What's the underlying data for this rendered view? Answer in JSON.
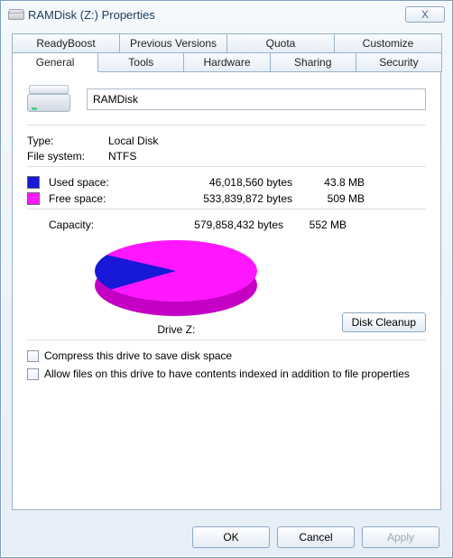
{
  "window": {
    "title": "RAMDisk (Z:) Properties",
    "close_glyph": "X"
  },
  "tabs_row1": {
    "readyboost": "ReadyBoost",
    "previous": "Previous Versions",
    "quota": "Quota",
    "customize": "Customize"
  },
  "tabs_row2": {
    "general": "General",
    "tools": "Tools",
    "hardware": "Hardware",
    "sharing": "Sharing",
    "security": "Security"
  },
  "drive": {
    "name_value": "RAMDisk",
    "type_label": "Type:",
    "type_value": "Local Disk",
    "fs_label": "File system:",
    "fs_value": "NTFS"
  },
  "space": {
    "used_label": "Used space:",
    "used_bytes": "46,018,560 bytes",
    "used_mb": "43.8 MB",
    "free_label": "Free space:",
    "free_bytes": "533,839,872 bytes",
    "free_mb": "509 MB",
    "capacity_label": "Capacity:",
    "capacity_bytes": "579,858,432 bytes",
    "capacity_mb": "552 MB"
  },
  "pie": {
    "drive_label": "Drive Z:",
    "cleanup_button": "Disk Cleanup"
  },
  "checks": {
    "compress": "Compress this drive to save disk space",
    "index": "Allow files on this drive to have contents indexed in addition to file properties"
  },
  "footer": {
    "ok": "OK",
    "cancel": "Cancel",
    "apply": "Apply"
  },
  "colors": {
    "used": "#1818d8",
    "free": "#ff18ff"
  },
  "chart_data": {
    "type": "pie",
    "title": "Drive Z:",
    "series": [
      {
        "name": "Used space",
        "value": 46018560,
        "display": "43.8 MB",
        "color": "#1818d8"
      },
      {
        "name": "Free space",
        "value": 533839872,
        "display": "509 MB",
        "color": "#ff18ff"
      }
    ],
    "total": {
      "name": "Capacity",
      "value": 579858432,
      "display": "552 MB"
    }
  }
}
